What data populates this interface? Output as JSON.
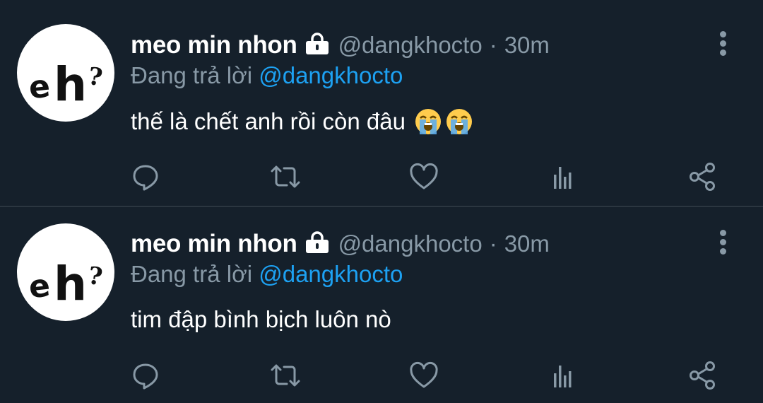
{
  "tweets": [
    {
      "avatar_text": "eh?",
      "display_name": "meo min nhon",
      "handle": "@dangkhocto",
      "separator": "·",
      "time": "30m",
      "replying_label": "Đang trả lời",
      "replying_to": "@dangkhocto",
      "text": "thế là chết anh rồi còn đâu",
      "emojis": [
        "loudly-crying-face",
        "loudly-crying-face"
      ]
    },
    {
      "avatar_text": "eh?",
      "display_name": "meo min nhon",
      "handle": "@dangkhocto",
      "separator": "·",
      "time": "30m",
      "replying_label": "Đang trả lời",
      "replying_to": "@dangkhocto",
      "text": "tim đập bình bịch luôn nò",
      "emojis": []
    }
  ],
  "colors": {
    "background": "#15202b",
    "primary_text": "#ffffff",
    "secondary_text": "#8899a6",
    "link": "#1da1f2",
    "divider": "#2b3640"
  },
  "icons": {
    "lock": "lock-icon",
    "more": "more-vertical-icon",
    "reply": "reply-icon",
    "retweet": "retweet-icon",
    "like": "heart-icon",
    "stats": "analytics-icon",
    "share": "share-icon"
  }
}
